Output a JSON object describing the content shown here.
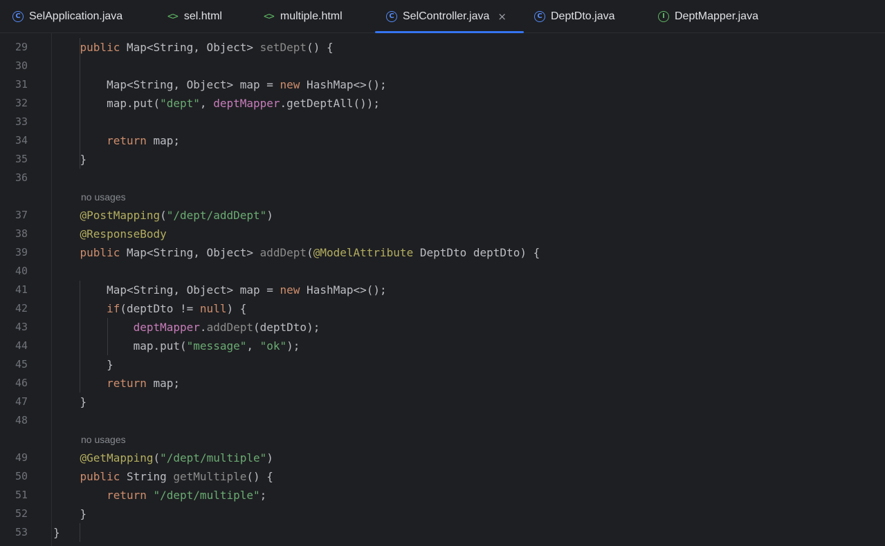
{
  "tabs": [
    {
      "label": "SelApplication.java",
      "icon": "class-icon",
      "active": false
    },
    {
      "label": "sel.html",
      "icon": "html-icon",
      "active": false
    },
    {
      "label": "multiple.html",
      "icon": "html-icon",
      "active": false
    },
    {
      "label": "SelController.java",
      "icon": "class-icon",
      "active": true,
      "close": "×"
    },
    {
      "label": "DeptDto.java",
      "icon": "class-icon",
      "active": false
    },
    {
      "label": "DeptMapper.java",
      "icon": "interface-icon",
      "active": false
    }
  ],
  "hints": {
    "h1": "no usages",
    "h2": "no usages"
  },
  "lines": [
    {
      "n": "29",
      "text": "    public Map<String, Object> setDept() {"
    },
    {
      "n": "30",
      "text": ""
    },
    {
      "n": "31",
      "text": "        Map<String, Object> map = new HashMap<>();"
    },
    {
      "n": "32",
      "text": "        map.put(\"dept\", deptMapper.getDeptAll());"
    },
    {
      "n": "33",
      "text": ""
    },
    {
      "n": "34",
      "text": "        return map;"
    },
    {
      "n": "35",
      "text": "    }"
    },
    {
      "n": "36",
      "text": ""
    },
    {
      "n": "37",
      "text": "    @PostMapping(\"/dept/addDept\")"
    },
    {
      "n": "38",
      "text": "    @ResponseBody"
    },
    {
      "n": "39",
      "text": "    public Map<String, Object> addDept(@ModelAttribute DeptDto deptDto) {"
    },
    {
      "n": "40",
      "text": ""
    },
    {
      "n": "41",
      "text": "        Map<String, Object> map = new HashMap<>();"
    },
    {
      "n": "42",
      "text": "        if(deptDto != null) {"
    },
    {
      "n": "43",
      "text": "            deptMapper.addDept(deptDto);"
    },
    {
      "n": "44",
      "text": "            map.put(\"message\", \"ok\");"
    },
    {
      "n": "45",
      "text": "        }"
    },
    {
      "n": "46",
      "text": "        return map;"
    },
    {
      "n": "47",
      "text": "    }"
    },
    {
      "n": "48",
      "text": ""
    },
    {
      "n": "49",
      "text": "    @GetMapping(\"/dept/multiple\")"
    },
    {
      "n": "50",
      "text": "    public String getMultiple() {"
    },
    {
      "n": "51",
      "text": "        return \"/dept/multiple\";"
    },
    {
      "n": "52",
      "text": "    }"
    },
    {
      "n": "53",
      "text": "}"
    }
  ],
  "colors": {
    "background": "#1e1f22",
    "keyword": "#cf8e6d",
    "string": "#6aab73",
    "annotation": "#b3ae60",
    "field": "#c77dbb",
    "active_tab_underline": "#3574f0"
  }
}
